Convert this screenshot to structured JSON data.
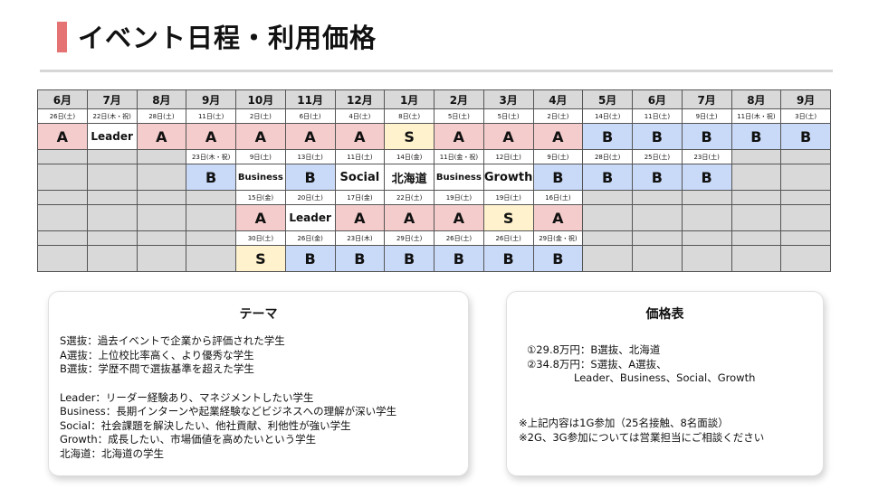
{
  "title": "イベント日程・利用価格",
  "months": [
    "6月",
    "7月",
    "8月",
    "9月",
    "10月",
    "11月",
    "12月",
    "1月",
    "2月",
    "3月",
    "4月",
    "5月",
    "6月",
    "7月",
    "8月",
    "9月"
  ],
  "rows": [
    {
      "type": "date",
      "cells": [
        {
          "t": "26日(土)",
          "c": "white"
        },
        {
          "t": "22日(木・祝)",
          "c": "white"
        },
        {
          "t": "28日(土)",
          "c": "white"
        },
        {
          "t": "11日(土)",
          "c": "white"
        },
        {
          "t": "2日(土)",
          "c": "white"
        },
        {
          "t": "6日(土)",
          "c": "white"
        },
        {
          "t": "4日(土)",
          "c": "white"
        },
        {
          "t": "8日(土)",
          "c": "white"
        },
        {
          "t": "5日(土)",
          "c": "white"
        },
        {
          "t": "5日(土)",
          "c": "white"
        },
        {
          "t": "2日(土)",
          "c": "white"
        },
        {
          "t": "14日(土)",
          "c": "white"
        },
        {
          "t": "11日(土)",
          "c": "white"
        },
        {
          "t": "9日(土)",
          "c": "white"
        },
        {
          "t": "11日(木・祝)",
          "c": "white"
        },
        {
          "t": "3日(土)",
          "c": "white"
        }
      ]
    },
    {
      "type": "code",
      "cells": [
        {
          "t": "A",
          "c": "pink"
        },
        {
          "t": "Leader",
          "c": "white",
          "s": "med"
        },
        {
          "t": "A",
          "c": "pink"
        },
        {
          "t": "A",
          "c": "pink"
        },
        {
          "t": "A",
          "c": "pink"
        },
        {
          "t": "A",
          "c": "pink"
        },
        {
          "t": "A",
          "c": "pink"
        },
        {
          "t": "S",
          "c": "yellow"
        },
        {
          "t": "A",
          "c": "pink"
        },
        {
          "t": "A",
          "c": "pink"
        },
        {
          "t": "A",
          "c": "pink"
        },
        {
          "t": "B",
          "c": "blue"
        },
        {
          "t": "B",
          "c": "blue"
        },
        {
          "t": "B",
          "c": "blue"
        },
        {
          "t": "B",
          "c": "blue"
        },
        {
          "t": "B",
          "c": "blue"
        }
      ]
    },
    {
      "type": "date",
      "cells": [
        {
          "t": "",
          "c": "gray"
        },
        {
          "t": "",
          "c": "gray"
        },
        {
          "t": "",
          "c": "gray"
        },
        {
          "t": "23日(木・祝)",
          "c": "white"
        },
        {
          "t": "9日(土)",
          "c": "white"
        },
        {
          "t": "13日(土)",
          "c": "white"
        },
        {
          "t": "11日(土)",
          "c": "white"
        },
        {
          "t": "14日(金)",
          "c": "white"
        },
        {
          "t": "11日(金・祝)",
          "c": "white"
        },
        {
          "t": "12日(土)",
          "c": "white"
        },
        {
          "t": "9日(土)",
          "c": "white"
        },
        {
          "t": "28日(土)",
          "c": "white"
        },
        {
          "t": "25日(土)",
          "c": "white"
        },
        {
          "t": "23日(土)",
          "c": "white"
        },
        {
          "t": "",
          "c": "gray"
        },
        {
          "t": "",
          "c": "gray"
        }
      ]
    },
    {
      "type": "code",
      "cells": [
        {
          "t": "",
          "c": "gray"
        },
        {
          "t": "",
          "c": "gray"
        },
        {
          "t": "",
          "c": "gray"
        },
        {
          "t": "B",
          "c": "blue"
        },
        {
          "t": "Business",
          "c": "white",
          "s": "small"
        },
        {
          "t": "B",
          "c": "blue"
        },
        {
          "t": "Social",
          "c": "white",
          "s": "word"
        },
        {
          "t": "北海道",
          "c": "white",
          "s": "word"
        },
        {
          "t": "Business",
          "c": "white",
          "s": "small"
        },
        {
          "t": "Growth",
          "c": "white",
          "s": "word"
        },
        {
          "t": "B",
          "c": "blue"
        },
        {
          "t": "B",
          "c": "blue"
        },
        {
          "t": "B",
          "c": "blue"
        },
        {
          "t": "B",
          "c": "blue"
        },
        {
          "t": "",
          "c": "gray"
        },
        {
          "t": "",
          "c": "gray"
        }
      ]
    },
    {
      "type": "date",
      "cells": [
        {
          "t": "",
          "c": "gray"
        },
        {
          "t": "",
          "c": "gray"
        },
        {
          "t": "",
          "c": "gray"
        },
        {
          "t": "",
          "c": "gray"
        },
        {
          "t": "15日(金)",
          "c": "white"
        },
        {
          "t": "20日(土)",
          "c": "white"
        },
        {
          "t": "17日(金)",
          "c": "white"
        },
        {
          "t": "22日(土)",
          "c": "white"
        },
        {
          "t": "19日(土)",
          "c": "white"
        },
        {
          "t": "19日(土)",
          "c": "white"
        },
        {
          "t": "16日(土)",
          "c": "white"
        },
        {
          "t": "",
          "c": "gray"
        },
        {
          "t": "",
          "c": "gray"
        },
        {
          "t": "",
          "c": "gray"
        },
        {
          "t": "",
          "c": "gray"
        },
        {
          "t": "",
          "c": "gray"
        }
      ]
    },
    {
      "type": "code",
      "cells": [
        {
          "t": "",
          "c": "gray"
        },
        {
          "t": "",
          "c": "gray"
        },
        {
          "t": "",
          "c": "gray"
        },
        {
          "t": "",
          "c": "gray"
        },
        {
          "t": "A",
          "c": "pink"
        },
        {
          "t": "Leader",
          "c": "white",
          "s": "med"
        },
        {
          "t": "A",
          "c": "pink"
        },
        {
          "t": "A",
          "c": "pink"
        },
        {
          "t": "A",
          "c": "pink"
        },
        {
          "t": "S",
          "c": "yellow"
        },
        {
          "t": "A",
          "c": "pink"
        },
        {
          "t": "",
          "c": "gray"
        },
        {
          "t": "",
          "c": "gray"
        },
        {
          "t": "",
          "c": "gray"
        },
        {
          "t": "",
          "c": "gray"
        },
        {
          "t": "",
          "c": "gray"
        }
      ]
    },
    {
      "type": "date",
      "cells": [
        {
          "t": "",
          "c": "gray"
        },
        {
          "t": "",
          "c": "gray"
        },
        {
          "t": "",
          "c": "gray"
        },
        {
          "t": "",
          "c": "gray"
        },
        {
          "t": "30日(土)",
          "c": "white"
        },
        {
          "t": "26日(金)",
          "c": "white"
        },
        {
          "t": "23日(木)",
          "c": "white"
        },
        {
          "t": "29日(土)",
          "c": "white"
        },
        {
          "t": "26日(土)",
          "c": "white"
        },
        {
          "t": "26日(土)",
          "c": "white"
        },
        {
          "t": "29日(金・祝)",
          "c": "white"
        },
        {
          "t": "",
          "c": "gray"
        },
        {
          "t": "",
          "c": "gray"
        },
        {
          "t": "",
          "c": "gray"
        },
        {
          "t": "",
          "c": "gray"
        },
        {
          "t": "",
          "c": "gray"
        }
      ]
    },
    {
      "type": "code",
      "cells": [
        {
          "t": "",
          "c": "gray"
        },
        {
          "t": "",
          "c": "gray"
        },
        {
          "t": "",
          "c": "gray"
        },
        {
          "t": "",
          "c": "gray"
        },
        {
          "t": "S",
          "c": "yellow"
        },
        {
          "t": "B",
          "c": "blue"
        },
        {
          "t": "B",
          "c": "blue"
        },
        {
          "t": "B",
          "c": "blue"
        },
        {
          "t": "B",
          "c": "blue"
        },
        {
          "t": "B",
          "c": "blue"
        },
        {
          "t": "B",
          "c": "blue"
        },
        {
          "t": "",
          "c": "gray"
        },
        {
          "t": "",
          "c": "gray"
        },
        {
          "t": "",
          "c": "gray"
        },
        {
          "t": "",
          "c": "gray"
        },
        {
          "t": "",
          "c": "gray"
        }
      ]
    }
  ],
  "theme": {
    "heading": "テーマ",
    "group1": [
      "S選抜：過去イベントで企業から評価された学生",
      "A選抜：上位校比率高く、より優秀な学生",
      "B選抜：学歴不問で選抜基準を超えた学生"
    ],
    "group2": [
      "Leader：リーダー経験あり、マネジメントしたい学生",
      "Business：長期インターンや起業経験などビジネスへの理解が深い学生",
      "Social：社会課題を解決したい、他社貢献、利他性が強い学生",
      "Growth：成長したい、市場価値を高めたいという学生",
      "北海道：北海道の学生"
    ]
  },
  "price": {
    "heading": "価格表",
    "line1": "①29.8万円：B選抜、北海道",
    "line2": "②34.8万円：S選抜、A選抜、",
    "line3": "Leader、Business、Social、Growth",
    "note1": "※上記内容は1G参加（25名接触、8名面談）",
    "note2": "※2G、3G参加については営業担当にご相談ください"
  }
}
